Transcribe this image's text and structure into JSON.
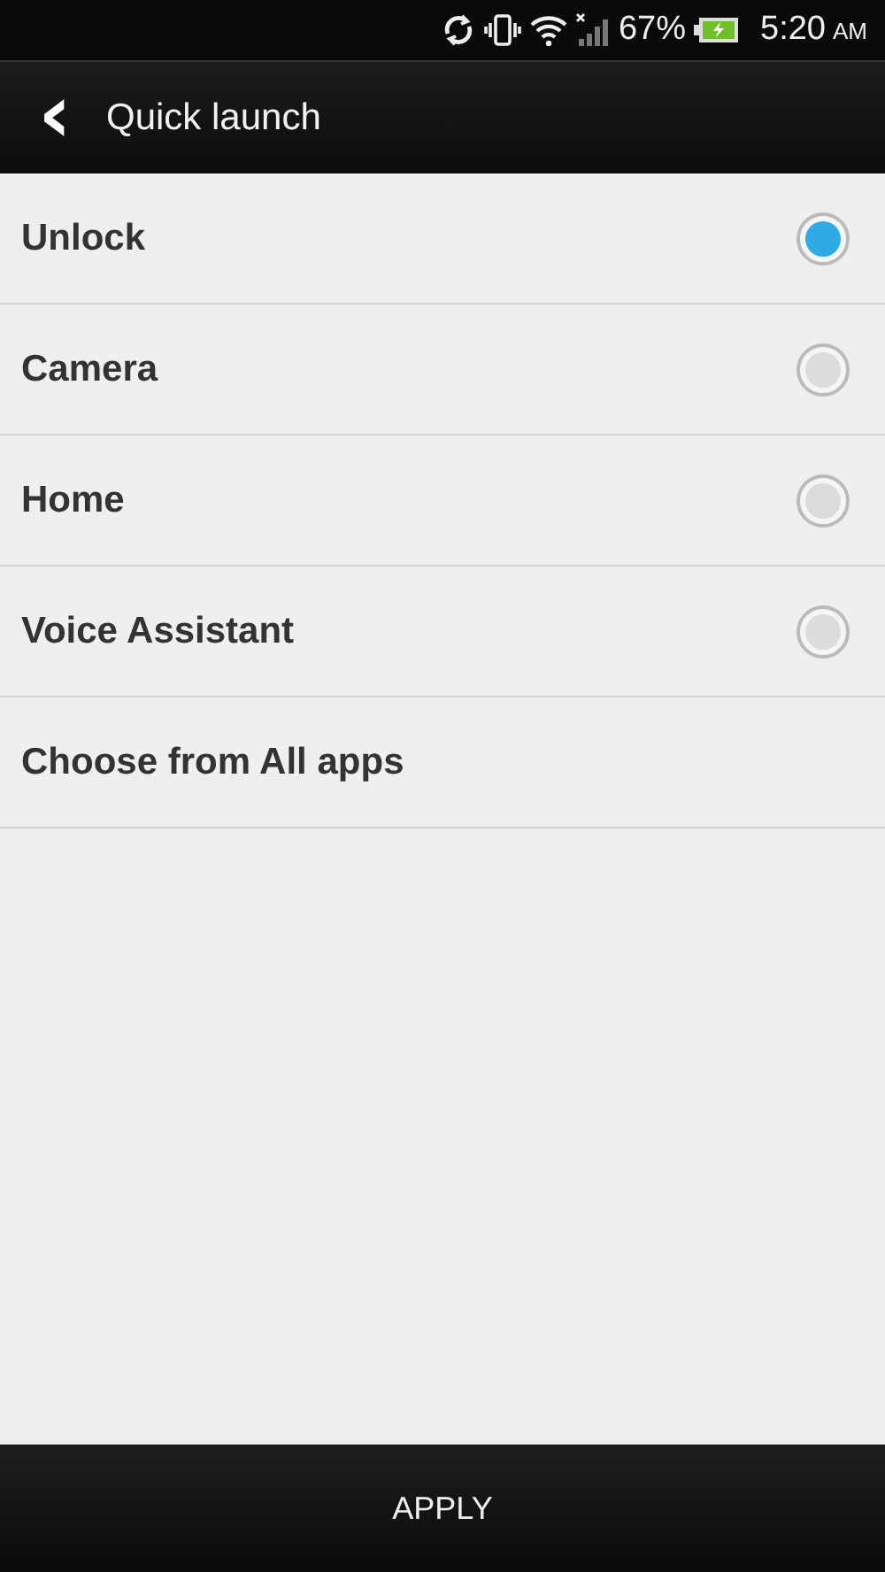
{
  "status_bar": {
    "battery_percent": "67%",
    "time": "5:20",
    "meridiem": "AM"
  },
  "action_bar": {
    "back": "‹",
    "title": "Quick launch"
  },
  "options": [
    {
      "label": "Unlock",
      "kind": "radio",
      "selected": true
    },
    {
      "label": "Camera",
      "kind": "radio",
      "selected": false
    },
    {
      "label": "Home",
      "kind": "radio",
      "selected": false
    },
    {
      "label": "Voice Assistant",
      "kind": "radio",
      "selected": false
    },
    {
      "label": "Choose from All apps",
      "kind": "link"
    }
  ],
  "bottom_bar": {
    "button": "APPLY"
  }
}
